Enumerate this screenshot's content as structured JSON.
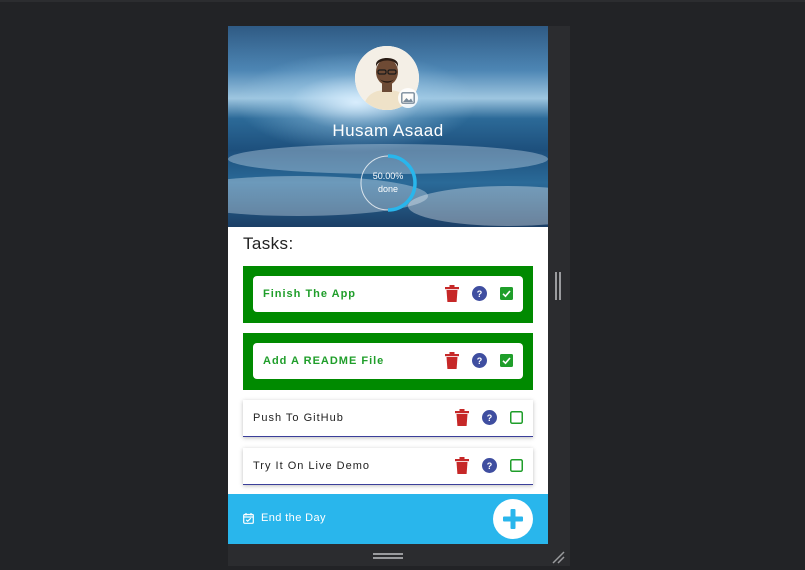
{
  "profile": {
    "name": "Husam Asaad",
    "progress_value": "50.00%",
    "progress_suffix": "done",
    "progress_fraction": 0.5,
    "photo_badge_icon": "image-icon"
  },
  "tasks_section": {
    "title": "Tasks:",
    "items": [
      {
        "label": "Finish The App",
        "done": true
      },
      {
        "label": "Add A README File",
        "done": true
      },
      {
        "label": "Push To GitHub",
        "done": false
      },
      {
        "label": "Try It On Live Demo",
        "done": false
      }
    ],
    "icons": {
      "delete": "trash-icon",
      "info": "help-icon",
      "status": "checkbox-icon"
    }
  },
  "footer": {
    "label": "End the Day",
    "icon": "calendar-check-icon",
    "add_icon": "plus-icon"
  },
  "colors": {
    "done_bg": "#008a00",
    "done_text": "#1f9e2a",
    "trash": "#c62828",
    "help": "#3f4ea0",
    "checkbox": "#1f9e2a",
    "footer": "#29b6ec",
    "todo_underline": "#3b3f9a"
  }
}
